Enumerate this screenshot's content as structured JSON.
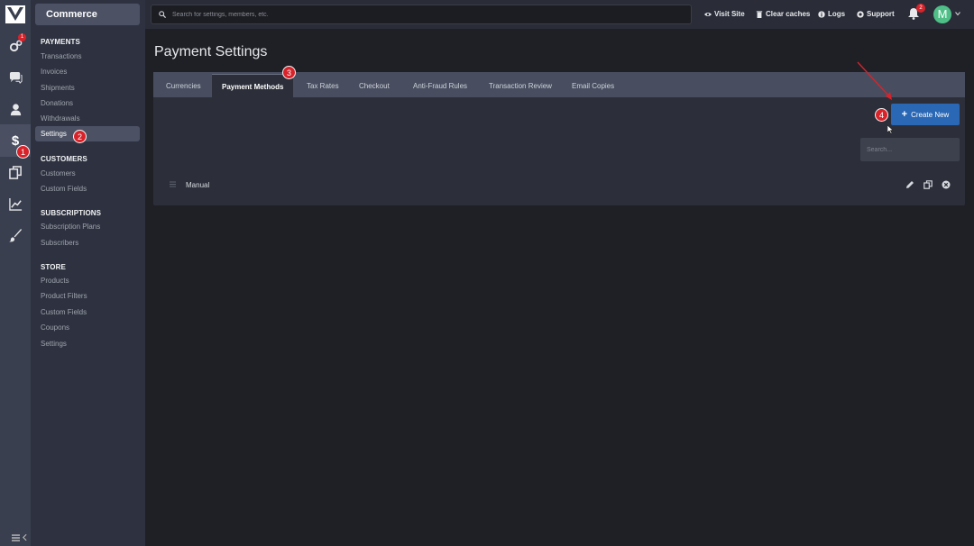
{
  "sidebar": {
    "section": "Commerce",
    "groups": [
      {
        "title": "PAYMENTS",
        "items": [
          "Transactions",
          "Invoices",
          "Shipments",
          "Donations",
          "Withdrawals",
          "Settings"
        ]
      },
      {
        "title": "CUSTOMERS",
        "items": [
          "Customers",
          "Custom Fields"
        ]
      },
      {
        "title": "SUBSCRIPTIONS",
        "items": [
          "Subscription Plans",
          "Subscribers"
        ]
      },
      {
        "title": "STORE",
        "items": [
          "Products",
          "Product Filters",
          "Custom Fields",
          "Coupons",
          "Settings"
        ]
      }
    ]
  },
  "rail": {
    "icons": [
      "logo-icon",
      "addons-gear-icon",
      "chat-icon",
      "user-icon",
      "dollar-icon",
      "copy-icon",
      "chart-icon",
      "brush-icon"
    ],
    "gear_badge": "1"
  },
  "topbar": {
    "search_placeholder": "Search for settings, members, etc.",
    "visit_site": "Visit Site",
    "clear_caches": "Clear caches",
    "logs": "Logs",
    "support": "Support",
    "notifications_count": "2",
    "avatar_letter": "M"
  },
  "main": {
    "title": "Payment Settings",
    "tabs": [
      "Currencies",
      "Payment Methods",
      "Tax Rates",
      "Checkout",
      "Anti-Fraud Rules",
      "Transaction Review",
      "Email Copies"
    ],
    "active_tab": "Payment Methods",
    "create_label": "Create New",
    "search_placeholder": "Search...",
    "rows": [
      {
        "label": "Manual"
      }
    ]
  },
  "annotations": [
    "1",
    "2",
    "3",
    "4"
  ],
  "colors": {
    "accent": "#2a67b5",
    "badge": "#d8232a",
    "avatar": "#4fbf87"
  }
}
